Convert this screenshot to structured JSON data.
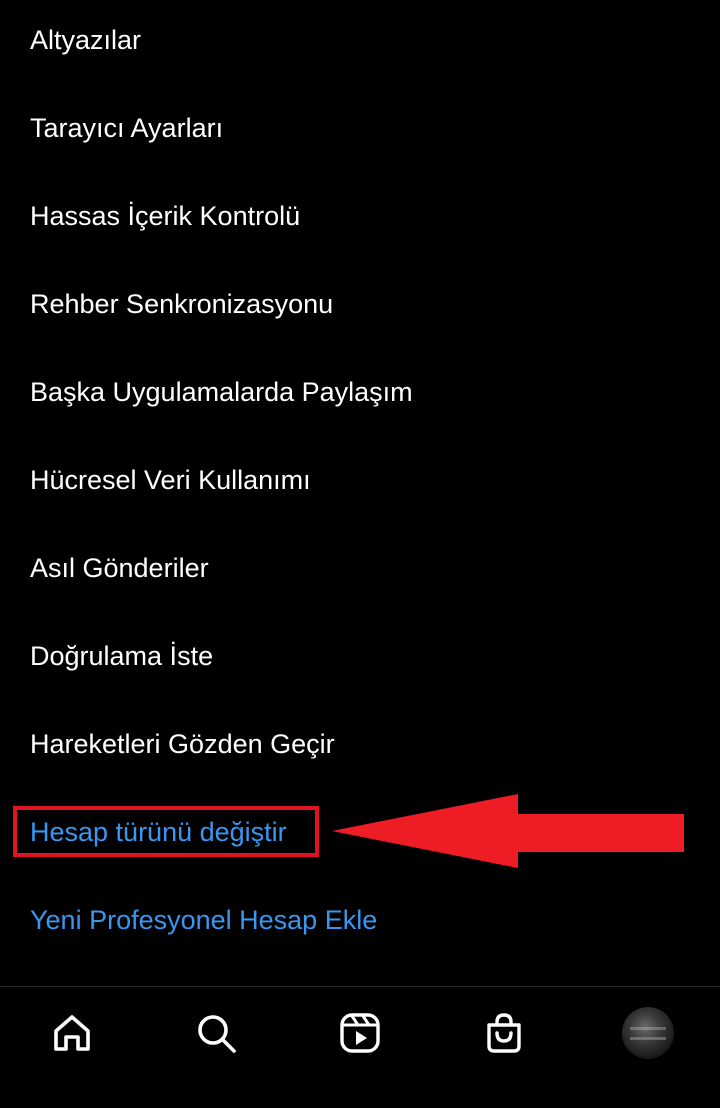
{
  "menu": {
    "items": [
      {
        "label": "Altyazılar"
      },
      {
        "label": "Tarayıcı Ayarları"
      },
      {
        "label": "Hassas İçerik Kontrolü"
      },
      {
        "label": "Rehber Senkronizasyonu"
      },
      {
        "label": "Başka Uygulamalarda Paylaşım"
      },
      {
        "label": "Hücresel Veri Kullanımı"
      },
      {
        "label": "Asıl Gönderiler"
      },
      {
        "label": "Doğrulama İste"
      },
      {
        "label": "Hareketleri Gözden Geçir"
      }
    ],
    "switch_account_type": "Hesap türünü değiştir",
    "add_professional_account": "Yeni Profesyonel Hesap Ekle"
  },
  "annotation": {
    "highlight_color": "#e0141e",
    "arrow_color": "#ee1c25"
  },
  "navbar": {
    "icons": [
      "home-icon",
      "search-icon",
      "reels-icon",
      "shop-icon",
      "profile-avatar"
    ]
  },
  "colors": {
    "background": "#000000",
    "text": "#ffffff",
    "link": "#3897f0"
  }
}
